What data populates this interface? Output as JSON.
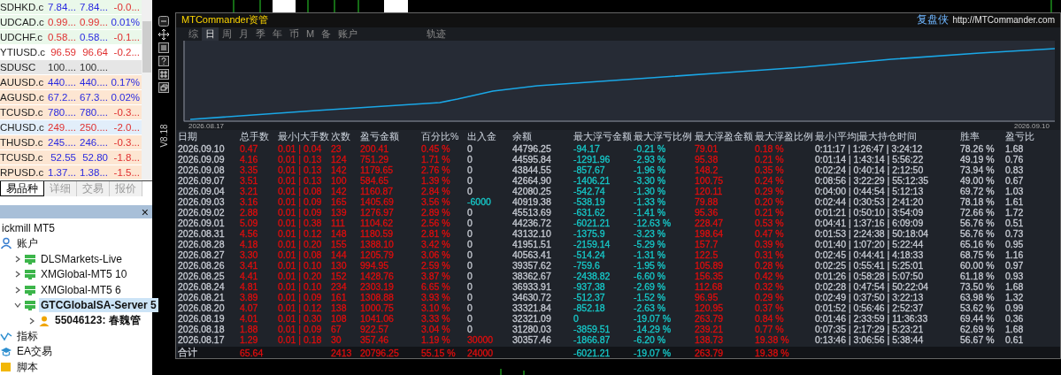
{
  "watchlist": {
    "rows": [
      {
        "symbol": "SDHKD.c",
        "bid": "7.84...",
        "ask": "7.84...",
        "change": "-0.0...",
        "color": "#eaf8ea",
        "bid_rising": true,
        "ask_rising": true,
        "change_rising": false
      },
      {
        "symbol": "UDCAD.c",
        "bid": "0.99...",
        "ask": "0.99...",
        "change": "0.01%",
        "color": "#eaf8ea",
        "bid_rising": false,
        "ask_rising": false,
        "change_rising": true
      },
      {
        "symbol": "UDCHF.c",
        "bid": "0.58...",
        "ask": "0.58...",
        "change": "-0.1...",
        "color": "#eaf8ea",
        "bid_rising": false,
        "ask_rising": true,
        "change_rising": false
      },
      {
        "symbol": "YTIUSD.c",
        "bid": "96.59",
        "ask": "96.64",
        "change": "-0.2...",
        "color": "#ffffff",
        "bid_rising": false,
        "ask_rising": false,
        "change_rising": false
      },
      {
        "symbol": "SDUSC",
        "bid": "100....",
        "ask": "100....",
        "color": "#e6e6e6"
      },
      {
        "symbol": "AUUSD.c",
        "bid": "440....",
        "ask": "440....",
        "change": "0.17%",
        "color": "#fde6d2",
        "bid_rising": true,
        "ask_rising": true,
        "change_rising": true
      },
      {
        "symbol": "AGUSD.c",
        "bid": "67.2...",
        "ask": "67.3...",
        "change": "0.02%",
        "color": "#fde6d2",
        "bid_rising": true,
        "ask_rising": true,
        "change_rising": true
      },
      {
        "symbol": "TCUSD.c",
        "bid": "780....",
        "ask": "780....",
        "change": "-0.3...",
        "color": "#fde6d2",
        "bid_rising": true,
        "ask_rising": true,
        "change_rising": false
      },
      {
        "symbol": "CHUSD.c",
        "bid": "249....",
        "ask": "250....",
        "change": "-2.0...",
        "color": "#e2eefa",
        "bid_rising": false,
        "ask_rising": false,
        "change_rising": false
      },
      {
        "symbol": "THUSD.c",
        "bid": "245....",
        "ask": "246....",
        "change": "-0.3...",
        "color": "#fde6d2",
        "bid_rising": true,
        "ask_rising": true,
        "change_rising": false
      },
      {
        "symbol": "TCUSD.c",
        "bid": "52.55",
        "ask": "52.80",
        "change": "-1.8...",
        "color": "#fde6d2",
        "bid_rising": true,
        "ask_rising": true,
        "change_rising": false
      },
      {
        "symbol": "RPUSD.c",
        "bid": "1.37...",
        "ask": "1.38...",
        "change": "-1.5...",
        "color": "#fde6d2",
        "bid_rising": true,
        "ask_rising": true,
        "change_rising": false
      }
    ]
  },
  "left_tabs": [
    {
      "label": "易品种",
      "selected": true
    },
    {
      "label": "详细",
      "selected": false
    },
    {
      "label": "交易",
      "selected": false
    },
    {
      "label": "报价",
      "selected": false
    }
  ],
  "navigator": {
    "close": "×",
    "tree": [
      {
        "label": "ickmill MT5",
        "selected": false,
        "children": [
          {
            "label": "账户",
            "kind": "account",
            "selected": false,
            "children": [
              {
                "label": "DLSMarkets-Live",
                "kind": "server",
                "selected": false,
                "expanded": false
              },
              {
                "label": "XMGlobal-MT5 10",
                "kind": "server",
                "selected": false,
                "expanded": false
              },
              {
                "label": "XMGlobal-MT5 6",
                "kind": "server",
                "selected": false,
                "expanded": false
              },
              {
                "label": "GTCGlobalSA-Server 5",
                "kind": "server",
                "selected": true,
                "expanded": true,
                "children": [
                  {
                    "label": "55046123: 春魏管",
                    "kind": "user",
                    "selected": false,
                    "expanded": false
                  }
                ]
              }
            ]
          },
          {
            "label": "指标",
            "kind": "indicator",
            "selected": false
          },
          {
            "label": "EA交易",
            "kind": "expert",
            "selected": false
          },
          {
            "label": "脚本",
            "kind": "script",
            "selected": false
          }
        ]
      }
    ]
  },
  "commander": {
    "title": "MTCommander资管",
    "brand": "复盘侠",
    "url": "http://MTCommander.com",
    "version": "V8.18",
    "tabs": [
      {
        "label": "综",
        "selected": false
      },
      {
        "label": "日",
        "selected": true
      },
      {
        "label": "周",
        "selected": false
      },
      {
        "label": "月",
        "selected": false
      },
      {
        "label": "季",
        "selected": false
      },
      {
        "label": "年",
        "selected": false
      },
      {
        "label": "币",
        "selected": false
      },
      {
        "label": "M",
        "selected": false
      },
      {
        "label": "备",
        "selected": false
      },
      {
        "label": "账户",
        "selected": false
      },
      {
        "label": "轨迹",
        "selected": false
      }
    ],
    "chart": {
      "start_label": "2026.08.17",
      "end_label": "2026.09.10"
    },
    "table": {
      "columns": [
        {
          "label": "日期",
          "kind": "fixed",
          "color": "#c8ccd4"
        },
        {
          "label": "总手数",
          "kind": "fixed",
          "color": "#e00d0d"
        },
        {
          "label": "最小|大手数",
          "kind": "fixed",
          "color": "#e00d0d"
        },
        {
          "label": "次数",
          "kind": "fixed",
          "color": "#e00d0d"
        },
        {
          "label": "盈亏金额",
          "kind": "fixed",
          "color": "#e00d0d"
        },
        {
          "label": "百分比%",
          "kind": "fixed",
          "color": "#e00d0d"
        },
        {
          "label": "出入金",
          "kind": "flow"
        },
        {
          "label": "余额",
          "kind": "fixed",
          "color": "#c8ccd4"
        },
        {
          "label": "最大浮亏金额",
          "kind": "fixed",
          "color": "#16c9c9"
        },
        {
          "label": "最大浮亏比例",
          "kind": "fixed",
          "color": "#16c9c9"
        },
        {
          "label": "最大浮盈金额",
          "kind": "fixed",
          "color": "#e00d0d"
        },
        {
          "label": "最大浮盈比例",
          "kind": "fixed",
          "color": "#e00d0d"
        },
        {
          "label": "最小|平均|最大持仓时间",
          "kind": "fixed",
          "color": "#c8ccd4"
        },
        {
          "label": "胜率",
          "kind": "fixed",
          "color": "#c8ccd4"
        },
        {
          "label": "盈亏比",
          "kind": "fixed",
          "color": "#c8ccd4"
        }
      ],
      "rows": [
        {
          "cells": [
            "2026.09.10",
            "0.47",
            "0.01 | 0.04",
            "23",
            "200.41",
            "0.45 %",
            "0",
            "44796.25",
            "-94.17",
            "-0.21 %",
            "79.01",
            "0.18 %",
            "0:11:17 | 1:26:47 | 3:24:12",
            "78.26 %",
            "1.68"
          ]
        },
        {
          "cells": [
            "2026.09.09",
            "4.16",
            "0.01 | 0.13",
            "124",
            "751.29",
            "1.71 %",
            "0",
            "44595.84",
            "-1291.96",
            "-2.93 %",
            "95.38",
            "0.21 %",
            "0:01:14 | 1:43:14 | 5:56:22",
            "49.19 %",
            "0.76"
          ]
        },
        {
          "cells": [
            "2026.09.08",
            "3.35",
            "0.01 | 0.13",
            "142",
            "1179.65",
            "2.76 %",
            "0",
            "43844.55",
            "-857.67",
            "-1.96 %",
            "148.2",
            "0.35 %",
            "0:02:24 | 0:40:14 | 2:12:50",
            "73.94 %",
            "0.83"
          ]
        },
        {
          "cells": [
            "2026.09.07",
            "3.51",
            "0.01 | 0.13",
            "100",
            "584.65",
            "1.39 %",
            "0",
            "42664.90",
            "-1406.21",
            "-3.30 %",
            "100.75",
            "0.24 %",
            "0:08:56 | 3:22:29 | 55:12:35",
            "49.00 %",
            "0.67"
          ]
        },
        {
          "cells": [
            "2026.09.04",
            "3.21",
            "0.01 | 0.08",
            "142",
            "1160.87",
            "2.84 %",
            "0",
            "42080.25",
            "-542.74",
            "-1.30 %",
            "120.11",
            "0.29 %",
            "0:04:00 | 0:44:54 | 5:12:13",
            "69.72 %",
            "1.03"
          ]
        },
        {
          "color": "#16c9c9",
          "cells": [
            "2026.09.03",
            "3.16",
            "0.01 | 0.09",
            "165",
            "1405.69",
            "3.56 %",
            "-6000",
            "40919.38",
            "-538.19",
            "-1.33 %",
            "79.88",
            "0.20 %",
            "0:02:44 | 0:30:53 | 2:41:20",
            "78.18 %",
            "1.61"
          ]
        },
        {
          "cells": [
            "2026.09.02",
            "2.88",
            "0.01 | 0.09",
            "139",
            "1276.97",
            "2.89 %",
            "0",
            "45513.69",
            "-631.62",
            "-1.41 %",
            "95.36",
            "0.21 %",
            "0:01:21 | 0:50:10 | 3:54:09",
            "72.66 %",
            "1.72"
          ]
        },
        {
          "cells": [
            "2026.09.01",
            "5.09",
            "0.01 | 0.38",
            "111",
            "1104.62",
            "2.56 %",
            "0",
            "44236.72",
            "-6021.21",
            "-12.63 %",
            "228.47",
            "0.53 %",
            "0:04:41 | 1:37:16 | 6:09:09",
            "56.76 %",
            "0.51"
          ]
        },
        {
          "cells": [
            "2026.08.31",
            "4.56",
            "0.01 | 0.12",
            "148",
            "1180.59",
            "2.81 %",
            "0",
            "43132.10",
            "-1375.9",
            "-3.23 %",
            "198.64",
            "0.47 %",
            "0:01:53 | 2:24:38 | 50:18:04",
            "56.76 %",
            "0.73"
          ]
        },
        {
          "cells": [
            "2026.08.28",
            "4.18",
            "0.01 | 0.20",
            "155",
            "1388.10",
            "3.42 %",
            "0",
            "41951.51",
            "-2159.14",
            "-5.29 %",
            "157.7",
            "0.39 %",
            "0:01:40 | 1:07:20 | 5:22:44",
            "65.16 %",
            "0.95"
          ]
        },
        {
          "cells": [
            "2026.08.27",
            "3.30",
            "0.01 | 0.08",
            "144",
            "1205.79",
            "3.06 %",
            "0",
            "40563.41",
            "-514.24",
            "-1.31 %",
            "122.5",
            "0.31 %",
            "0:02:45 | 0:44:41 | 4:18:33",
            "68.75 %",
            "1.16"
          ]
        },
        {
          "cells": [
            "2026.08.26",
            "3.41",
            "0.01 | 0.10",
            "130",
            "994.95",
            "2.59 %",
            "0",
            "39357.62",
            "-759.6",
            "-1.95 %",
            "105.89",
            "0.28 %",
            "0:02:25 | 0:55:41 | 5:25:01",
            "60.00 %",
            "0.97"
          ]
        },
        {
          "cells": [
            "2026.08.25",
            "4.41",
            "0.01 | 0.20",
            "152",
            "1428.76",
            "3.87 %",
            "0",
            "38362.67",
            "-2438.82",
            "-6.60 %",
            "156.35",
            "0.42 %",
            "0:01:26 | 0:58:28 | 5:07:50",
            "61.18 %",
            "0.93"
          ]
        },
        {
          "cells": [
            "2026.08.24",
            "4.81",
            "0.01 | 0.10",
            "234",
            "2303.19",
            "6.65 %",
            "0",
            "36933.91",
            "-937.38",
            "-2.69 %",
            "112.68",
            "0.32 %",
            "0:02:28 | 0:47:54 | 50:22:04",
            "73.50 %",
            "1.68"
          ]
        },
        {
          "cells": [
            "2026.08.21",
            "3.89",
            "0.01 | 0.09",
            "161",
            "1308.88",
            "3.93 %",
            "0",
            "34630.72",
            "-512.37",
            "-1.52 %",
            "96.95",
            "0.29 %",
            "0:02:49 | 0:37:50 | 3:22:13",
            "63.98 %",
            "1.32"
          ]
        },
        {
          "cells": [
            "2026.08.20",
            "4.07",
            "0.01 | 0.12",
            "138",
            "1000.75",
            "3.10 %",
            "0",
            "33321.84",
            "-852.18",
            "-2.63 %",
            "120.95",
            "0.37 %",
            "0:01:52 | 0:56:46 | 2:52:37",
            "53.62 %",
            "0.99"
          ]
        },
        {
          "cells": [
            "2026.08.19",
            "4.01",
            "0.01 | 0.30",
            "108",
            "1041.06",
            "3.33 %",
            "0",
            "32321.09",
            "0",
            "-19.07 %",
            "263.79",
            "0.84 %",
            "0:01:46 | 2:33:59 | 11:36:33",
            "69.44 %",
            "0.36"
          ]
        },
        {
          "cells": [
            "2026.08.18",
            "1.88",
            "0.01 | 0.09",
            "67",
            "922.57",
            "3.04 %",
            "0",
            "31280.03",
            "-3859.51",
            "-14.29 %",
            "239.21",
            "0.77 %",
            "0:07:35 | 2:17:29 | 5:23:21",
            "62.69 %",
            "1.68"
          ]
        },
        {
          "color": "#e00d0d",
          "cells": [
            "2026.08.17",
            "1.29",
            "0.01 | 0.18",
            "30",
            "357.46",
            "1.19 %",
            "30000",
            "30357.46",
            "-1866.87",
            "-6.20 %",
            "138.73",
            "19.38 %",
            "0:13:46 | 3:06:56 | 5:38:44",
            "56.67 %",
            "0.61"
          ]
        }
      ],
      "total": {
        "color": "#e00d0d",
        "cells": [
          "合计",
          "65.64",
          null,
          "2413",
          "20796.25",
          "55.15 %",
          "24000",
          null,
          "-6021.21",
          "-19.07 %",
          "263.79",
          "19.38 %",
          null,
          null,
          null
        ]
      }
    }
  }
}
